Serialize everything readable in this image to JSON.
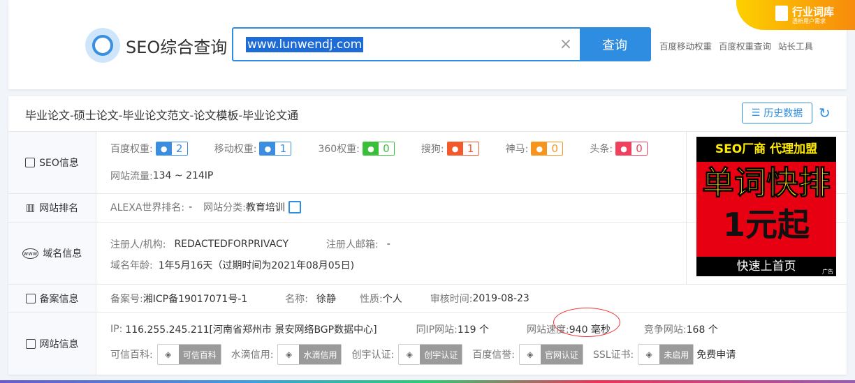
{
  "header": {
    "logo_text": "SEO综合查询",
    "search_value": "www.lunwendj.com",
    "search_button": "查询",
    "links": [
      "百度移动权重",
      "百度权重查询",
      "站长工具"
    ],
    "badge_title": "行业词库",
    "badge_sub": "透析用户需求"
  },
  "main": {
    "site_title": "毕业论文-硕士论文-毕业论文范文-论文模板-毕业论文通",
    "history_button": "历史数据",
    "seo": {
      "label": "SEO信息",
      "weights": [
        {
          "name": "百度权重:",
          "value": "2",
          "color": "#3b8de0",
          "icon": "baidu-paw-icon"
        },
        {
          "name": "移动权重:",
          "value": "1",
          "color": "#3b8de0",
          "icon": "baidu-mobile-icon"
        },
        {
          "name": "360权重:",
          "value": "0",
          "color": "#3bbf3b",
          "icon": "360-icon"
        },
        {
          "name": "搜狗:",
          "value": "1",
          "color": "#f25a2b",
          "icon": "sogou-icon"
        },
        {
          "name": "神马:",
          "value": "0",
          "color": "#f5951d",
          "icon": "shenma-icon"
        },
        {
          "name": "头条:",
          "value": "0",
          "color": "#f0425f",
          "icon": "toutiao-icon"
        }
      ],
      "traffic_label": "网站流量:",
      "traffic_value": "134 ~ 214IP"
    },
    "rank": {
      "label": "网站排名",
      "alexa_label": "ALEXA世界排名:",
      "alexa_value": "-",
      "category_label": "网站分类:",
      "category_value": "教育培训"
    },
    "domain": {
      "label": "域名信息",
      "registrant_label": "注册人/机构:",
      "registrant_value": "REDACTEDFORPRIVACY",
      "email_label": "注册人邮箱:",
      "email_value": "-",
      "age_label": "域名年龄:",
      "age_value": "1年5月16天（过期时间为2021年08月05日)"
    },
    "icp": {
      "label": "备案信息",
      "no_label": "备案号:",
      "no_value": "湘ICP备19017071号-1",
      "name_label": "名称:",
      "name_value": "徐静",
      "type_label": "性质:",
      "type_value": "个人",
      "date_label": "审核时间:",
      "date_value": "2019-08-23"
    },
    "site": {
      "label": "网站信息",
      "ip_label": "IP:",
      "ip_value": "116.255.245.211[河南省郑州市 景安网络BGP数据中心]",
      "sameip_label": "同IP网站:",
      "sameip_value": "119 个",
      "speed_label": "网站速度:",
      "speed_value": "940 毫秒",
      "compete_label": "竞争网站:",
      "compete_value": "168 个",
      "certs": [
        {
          "label": "可信百科:",
          "badge": "可信百科"
        },
        {
          "label": "水滴信用:",
          "badge": "水滴信用"
        },
        {
          "label": "创宇认证:",
          "badge": "创宇认证"
        },
        {
          "label": "百度信誉:",
          "badge": "官网认证"
        },
        {
          "label": "SSL证书:",
          "badge": "未启用"
        }
      ],
      "free_apply": "免费申请"
    },
    "ad": {
      "top": "SEO厂商 代理加盟",
      "line1": "单词快排",
      "line2": "1元起",
      "bottom": "快速上首页",
      "tag": "广告"
    }
  }
}
